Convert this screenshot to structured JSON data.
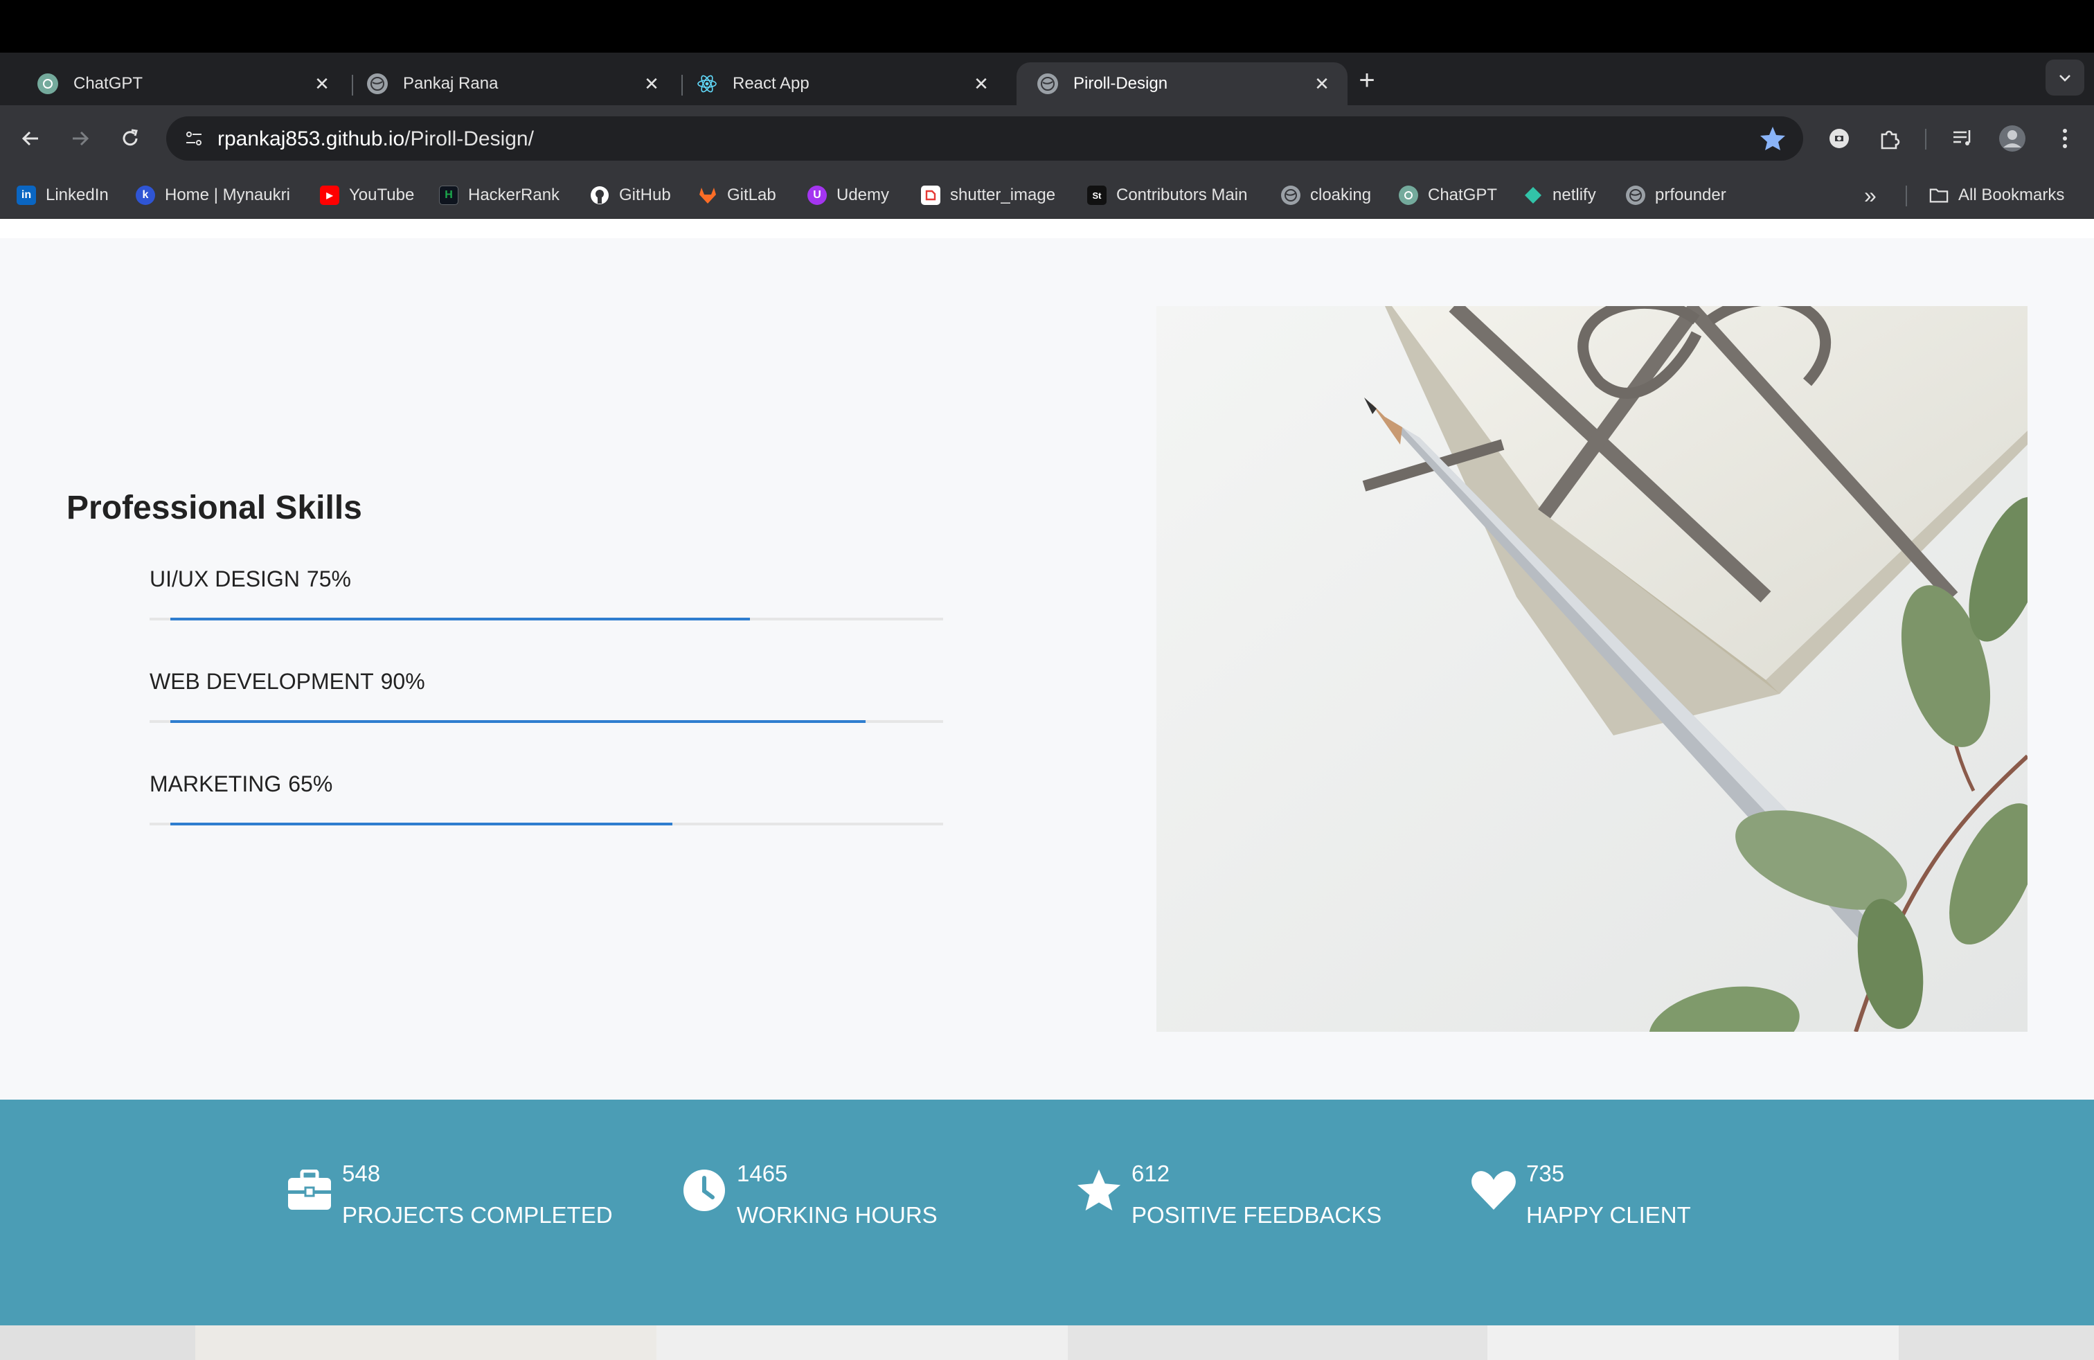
{
  "browser": {
    "tabs": [
      {
        "title": "ChatGPT",
        "active": false
      },
      {
        "title": "Pankaj Rana",
        "active": false
      },
      {
        "title": "React App",
        "active": false
      },
      {
        "title": "Piroll-Design",
        "active": true
      }
    ],
    "close_glyph": "✕",
    "new_tab_glyph": "+",
    "url_host": "rpankaj853.github.io",
    "url_path": "/Piroll-Design/",
    "bookmarks": [
      {
        "label": "LinkedIn",
        "icon": "linkedin-icon",
        "color": "#0a66c2",
        "glyph": "in"
      },
      {
        "label": "Home | Mynaukri",
        "icon": "mynaukri-icon",
        "color": "#2f55d4",
        "glyph": "k"
      },
      {
        "label": "YouTube",
        "icon": "youtube-icon",
        "color": "#ff0000",
        "glyph": "▶"
      },
      {
        "label": "HackerRank",
        "icon": "hackerrank-icon",
        "color": "#1ba94c",
        "glyph": "H"
      },
      {
        "label": "GitHub",
        "icon": "github-icon",
        "color": "#ffffff",
        "glyph": ""
      },
      {
        "label": "GitLab",
        "icon": "gitlab-icon",
        "color": "#fc6d26",
        "glyph": ""
      },
      {
        "label": "Udemy",
        "icon": "udemy-icon",
        "color": "#a435f0",
        "glyph": "U"
      },
      {
        "label": "shutter_image",
        "icon": "shutter-icon",
        "color": "#ffffff",
        "glyph": ""
      },
      {
        "label": "Contributors Main",
        "icon": "shutterstock-icon",
        "color": "#111111",
        "glyph": "St"
      },
      {
        "label": "cloaking",
        "icon": "globe-icon",
        "color": "#9aa0a6",
        "glyph": ""
      },
      {
        "label": "ChatGPT",
        "icon": "chatgpt-icon",
        "color": "#74aa9c",
        "glyph": ""
      },
      {
        "label": "netlify",
        "icon": "netlify-icon",
        "color": "#32c3a8",
        "glyph": ""
      },
      {
        "label": "prfounder",
        "icon": "globe-icon",
        "color": "#9aa0a6",
        "glyph": ""
      }
    ],
    "more_bookmarks_glyph": "»",
    "all_bookmarks_label": "All Bookmarks"
  },
  "skills": {
    "heading": "Professional Skills",
    "items": [
      {
        "name": "UI/UX DESIGN",
        "percent_label": "75%",
        "fraction": 0.75
      },
      {
        "name": "WEB DEVELOPMENT",
        "percent_label": "90%",
        "fraction": 0.9
      },
      {
        "name": "MARKETING",
        "percent_label": "65%",
        "fraction": 0.65
      }
    ]
  },
  "stats": [
    {
      "number": "548",
      "label": "PROJECTS COMPLETED",
      "icon": "briefcase-icon"
    },
    {
      "number": "1465",
      "label": "WORKING HOURS",
      "icon": "clock-icon"
    },
    {
      "number": "612",
      "label": "POSITIVE FEEDBACKS",
      "icon": "star-icon"
    },
    {
      "number": "735",
      "label": "HAPPY CLIENT",
      "icon": "heart-icon"
    }
  ],
  "colors": {
    "stats_background": "#4b9db5",
    "skill_bar": "#2f7ecf",
    "bookmark_star": "#8ab4f8"
  }
}
